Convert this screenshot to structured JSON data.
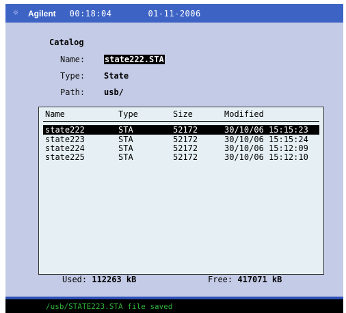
{
  "header": {
    "brand": "Agilent",
    "time": "00:18:04",
    "date": "01-11-2006",
    "icon": "sun-icon"
  },
  "catalog": {
    "title": "Catalog",
    "name_label": "Name:",
    "name_value": "state222.STA",
    "type_label": "Type:",
    "type_value": "State",
    "path_label": "Path:",
    "path_value": "usb/"
  },
  "file_list": {
    "columns": [
      "Name",
      "Type",
      "Size",
      "Modified"
    ],
    "rows": [
      {
        "name": "state222",
        "type": "STA",
        "size": "52172",
        "modified": "30/10/06 15:15:23",
        "selected": true
      },
      {
        "name": "state223",
        "type": "STA",
        "size": "52172",
        "modified": "30/10/06 15:15:24",
        "selected": false
      },
      {
        "name": "state224",
        "type": "STA",
        "size": "52172",
        "modified": "30/10/06 15:12:09",
        "selected": false
      },
      {
        "name": "state225",
        "type": "STA",
        "size": "52172",
        "modified": "30/10/06 15:12:10",
        "selected": false
      }
    ]
  },
  "usage": {
    "used_label": "Used:",
    "used_value": "112263 kB",
    "free_label": "Free:",
    "free_value": "417071 kB"
  },
  "status": {
    "message": "/usb/STATE223.STA file saved"
  }
}
